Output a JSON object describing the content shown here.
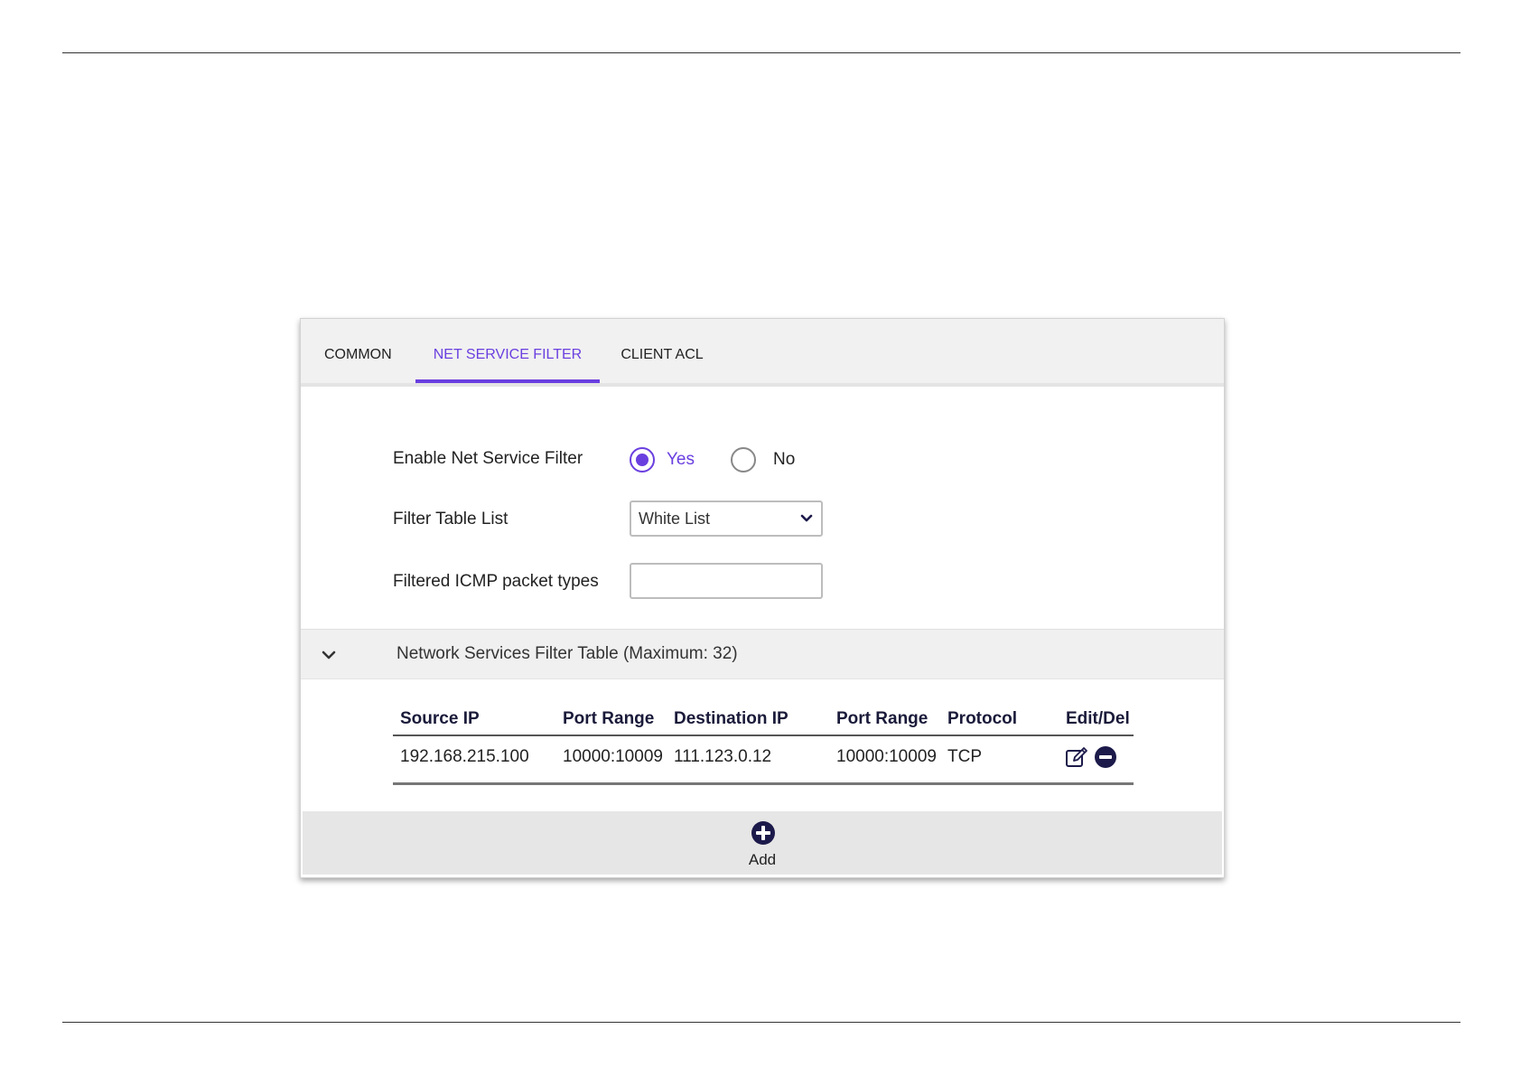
{
  "tabs": [
    {
      "label": "COMMON"
    },
    {
      "label": "NET SERVICE FILTER",
      "active": true
    },
    {
      "label": "CLIENT ACL"
    }
  ],
  "form": {
    "enable_label": "Enable Net Service Filter",
    "yes_label": "Yes",
    "no_label": "No",
    "enable_value": "Yes",
    "filter_table_label": "Filter Table List",
    "filter_table_value": "White List",
    "icmp_label": "Filtered ICMP packet types",
    "icmp_value": ""
  },
  "section": {
    "title": "Network Services Filter Table (Maximum: 32)"
  },
  "table": {
    "headers": [
      "Source IP",
      "Port Range",
      "Destination IP",
      "Port Range",
      "Protocol",
      "Edit/Del"
    ],
    "rows": [
      [
        "192.168.215.100",
        "10000:10009",
        "111.123.0.12",
        "10000:10009",
        "TCP"
      ]
    ]
  },
  "footer": {
    "add_label": "Add"
  },
  "colors": {
    "accent": "#6a3fe0",
    "icon_dark": "#1c1a4a"
  }
}
